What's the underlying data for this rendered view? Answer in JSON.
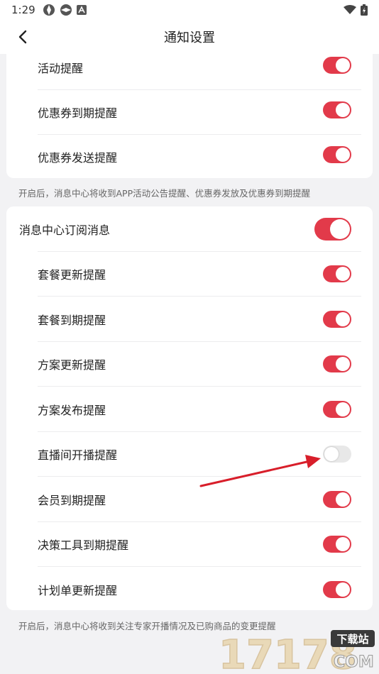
{
  "status": {
    "time": "1:29"
  },
  "header": {
    "title": "通知设置"
  },
  "section_a": {
    "items": [
      {
        "label": "活动提醒",
        "on": true
      },
      {
        "label": "优惠券到期提醒",
        "on": true
      },
      {
        "label": "优惠券发送提醒",
        "on": true
      }
    ],
    "note": "开启后，消息中心将收到APP活动公告提醒、优惠券发放及优惠券到期提醒"
  },
  "section_b": {
    "master": {
      "label": "消息中心订阅消息",
      "on": true
    },
    "items": [
      {
        "label": "套餐更新提醒",
        "on": true
      },
      {
        "label": "套餐到期提醒",
        "on": true
      },
      {
        "label": "方案更新提醒",
        "on": true
      },
      {
        "label": "方案发布提醒",
        "on": true
      },
      {
        "label": "直播间开播提醒",
        "on": false
      },
      {
        "label": "会员到期提醒",
        "on": true
      },
      {
        "label": "决策工具到期提醒",
        "on": true
      },
      {
        "label": "计划单更新提醒",
        "on": true
      }
    ],
    "note": "开启后，消息中心将收到关注专家开播情况及已购商品的变更提醒"
  },
  "watermark": {
    "number": "17178",
    "badge": "下载站",
    "suffix": "COM"
  },
  "colors": {
    "accent": "#e23a4a",
    "toggle_off": "#e8e8e8",
    "arrow": "#d81e2a"
  }
}
